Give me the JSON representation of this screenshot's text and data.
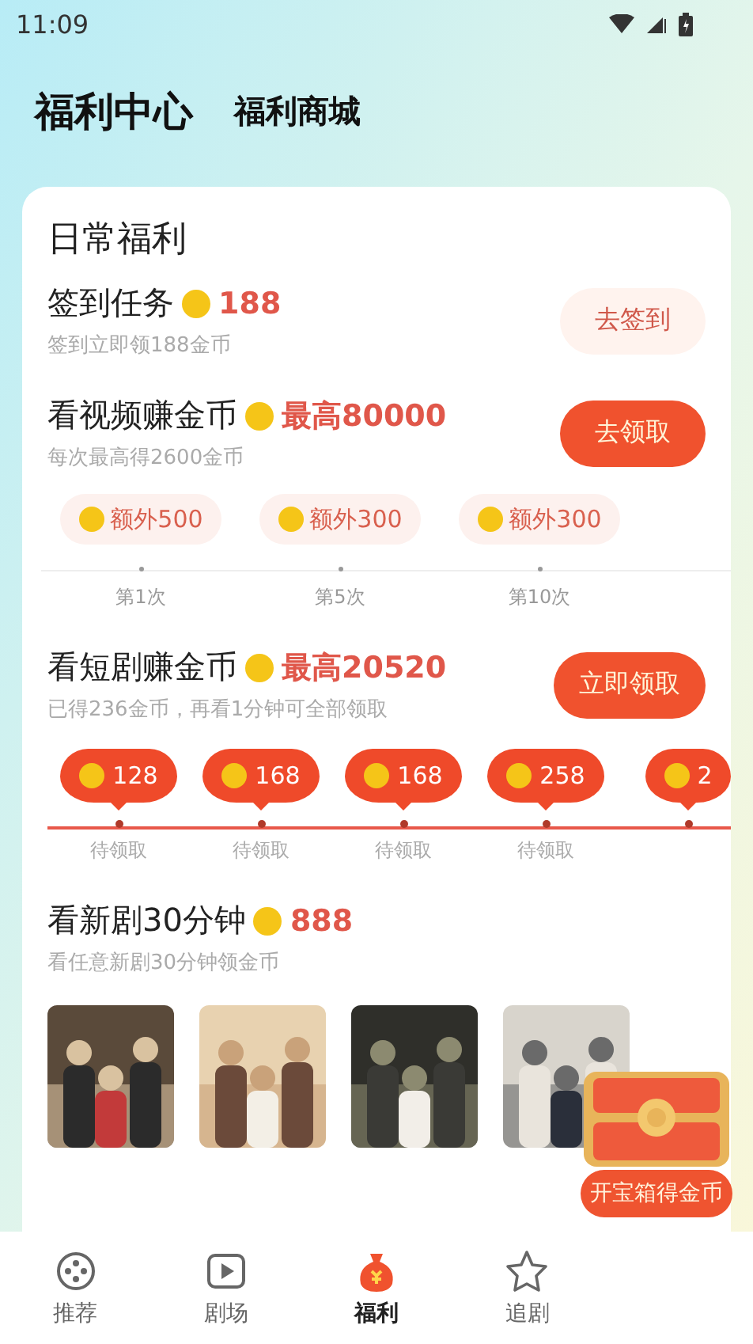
{
  "status_bar": {
    "time": "11:09"
  },
  "header_tabs": [
    {
      "label": "福利中心",
      "selected": true
    },
    {
      "label": "福利商城",
      "selected": false
    }
  ],
  "daily": {
    "title": "日常福利",
    "tasks": [
      {
        "kind": "sign_in",
        "title": "签到任务",
        "reward": "188",
        "subtitle": "签到立即领188金币",
        "button": {
          "label": "去签到",
          "primary": false
        }
      },
      {
        "kind": "video",
        "title": "看视频赚金币",
        "reward": "最高80000",
        "subtitle": "每次最高得2600金币",
        "button": {
          "label": "去领取",
          "primary": true
        },
        "milestones": [
          {
            "bonus": "额外500",
            "label": "第1次"
          },
          {
            "bonus": "额外300",
            "label": "第5次"
          },
          {
            "bonus": "额外300",
            "label": "第10次"
          }
        ]
      },
      {
        "kind": "drama",
        "title": "看短剧赚金币",
        "reward": "最高20520",
        "subtitle": "已得236金币，再看1分钟可全部领取",
        "button": {
          "label": "立即领取",
          "primary": true
        },
        "steps": [
          {
            "amount": "128",
            "label": "待领取"
          },
          {
            "amount": "168",
            "label": "待领取"
          },
          {
            "amount": "168",
            "label": "待领取"
          },
          {
            "amount": "258",
            "label": "待领取"
          },
          {
            "amount": "2"
          }
        ]
      },
      {
        "kind": "new_drama",
        "title": "看新剧30分钟",
        "reward": "888",
        "subtitle": "看任意新剧30分钟领金币"
      }
    ]
  },
  "chest": {
    "button": "开宝箱得金币"
  },
  "bottom_nav": [
    {
      "label": "推荐",
      "selected": false
    },
    {
      "label": "剧场",
      "selected": false
    },
    {
      "label": "福利",
      "selected": true
    },
    {
      "label": "追剧",
      "selected": false
    }
  ]
}
